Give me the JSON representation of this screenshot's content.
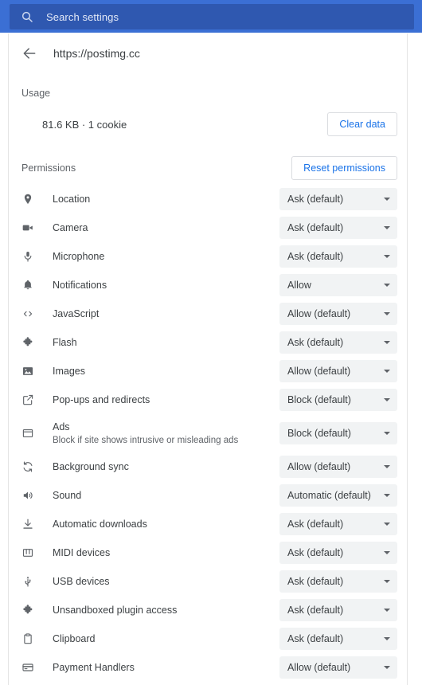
{
  "search": {
    "placeholder": "Search settings",
    "icon": "search-icon"
  },
  "header": {
    "back_icon": "back-arrow-icon",
    "site_url": "https://postimg.cc"
  },
  "usage": {
    "title": "Usage",
    "detail": "81.6 KB · 1 cookie",
    "clear_button": "Clear data"
  },
  "permissions": {
    "title": "Permissions",
    "reset_button": "Reset permissions",
    "items": [
      {
        "icon": "location-pin-icon",
        "label": "Location",
        "sub": "",
        "value": "Ask (default)"
      },
      {
        "icon": "camera-icon",
        "label": "Camera",
        "sub": "",
        "value": "Ask (default)"
      },
      {
        "icon": "microphone-icon",
        "label": "Microphone",
        "sub": "",
        "value": "Ask (default)"
      },
      {
        "icon": "bell-icon",
        "label": "Notifications",
        "sub": "",
        "value": "Allow"
      },
      {
        "icon": "code-brackets-icon",
        "label": "JavaScript",
        "sub": "",
        "value": "Allow (default)"
      },
      {
        "icon": "puzzle-piece-icon",
        "label": "Flash",
        "sub": "",
        "value": "Ask (default)"
      },
      {
        "icon": "image-icon",
        "label": "Images",
        "sub": "",
        "value": "Allow (default)"
      },
      {
        "icon": "external-link-icon",
        "label": "Pop-ups and redirects",
        "sub": "",
        "value": "Block (default)"
      },
      {
        "icon": "window-icon",
        "label": "Ads",
        "sub": "Block if site shows intrusive or misleading ads",
        "value": "Block (default)"
      },
      {
        "icon": "sync-icon",
        "label": "Background sync",
        "sub": "",
        "value": "Allow (default)"
      },
      {
        "icon": "speaker-icon",
        "label": "Sound",
        "sub": "",
        "value": "Automatic (default)"
      },
      {
        "icon": "download-icon",
        "label": "Automatic downloads",
        "sub": "",
        "value": "Ask (default)"
      },
      {
        "icon": "piano-keys-icon",
        "label": "MIDI devices",
        "sub": "",
        "value": "Ask (default)"
      },
      {
        "icon": "usb-icon",
        "label": "USB devices",
        "sub": "",
        "value": "Ask (default)"
      },
      {
        "icon": "puzzle-piece-icon",
        "label": "Unsandboxed plugin access",
        "sub": "",
        "value": "Ask (default)"
      },
      {
        "icon": "clipboard-icon",
        "label": "Clipboard",
        "sub": "",
        "value": "Ask (default)"
      },
      {
        "icon": "credit-card-icon",
        "label": "Payment Handlers",
        "sub": "",
        "value": "Allow (default)"
      }
    ]
  },
  "colors": {
    "header_blue": "#3B6FD4",
    "search_field_blue": "#2F58B0",
    "link_blue": "#1a73e8",
    "select_bg": "#f1f3f4",
    "text_primary": "#3c4043",
    "text_secondary": "#5f6368"
  }
}
